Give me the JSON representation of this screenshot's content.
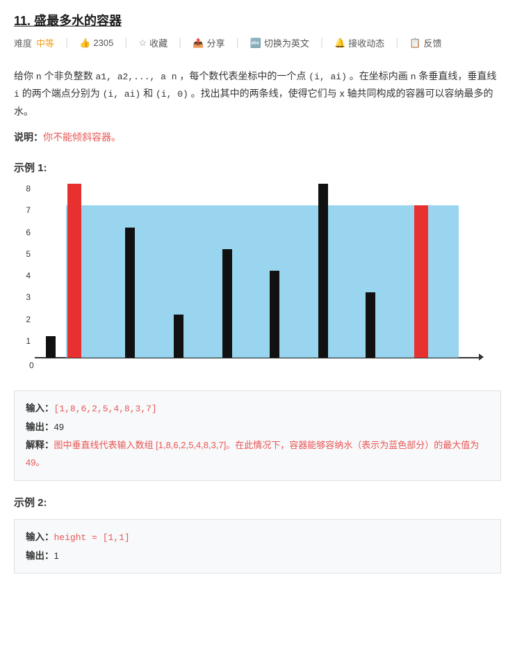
{
  "page": {
    "title": "11. 盛最多水的容器",
    "difficulty_label": "难度",
    "difficulty_value": "中等",
    "likes": "2305",
    "actions": {
      "collect": "收藏",
      "share": "分享",
      "translate": "切换为英文",
      "notify": "接收动态",
      "feedback": "反馈"
    },
    "description_parts": [
      "给你 n 个非负整数 a1, a2,..., a n ，每个数代表坐标中的一个点 (i, ai) 。在坐标内画 n 条垂直线，垂直线 i 的两个端点分别为 (i, ai) 和 (i, 0) 。找出其中的两条线，使得它们与 x 轴共同构成的容器可以容纳最多的水。"
    ],
    "note_label": "说明：",
    "note_content": "你不能倾斜容器。",
    "example1_title": "示例 1:",
    "chart": {
      "values": [
        1,
        8,
        6,
        2,
        5,
        4,
        8,
        3,
        7
      ],
      "highlighted_left": 1,
      "highlighted_right": 8,
      "water_level": 7,
      "water_start_bar": 1,
      "water_end_bar": 8
    },
    "example1_box": {
      "input_label": "输入：",
      "input_value": "[1,8,6,2,5,4,8,3,7]",
      "output_label": "输出：",
      "output_value": "49",
      "explain_label": "解释：",
      "explain_value": "图中垂直线代表输入数组 [1,8,6,2,5,4,8,3,7]。在此情况下，容器能够容纳水（表示为蓝色部分）的最大值为 49。"
    },
    "example2_title": "示例 2:",
    "example2_box": {
      "input_label": "输入：",
      "input_value": "height = [1,1]",
      "output_label": "输出：",
      "output_value": "1"
    }
  }
}
